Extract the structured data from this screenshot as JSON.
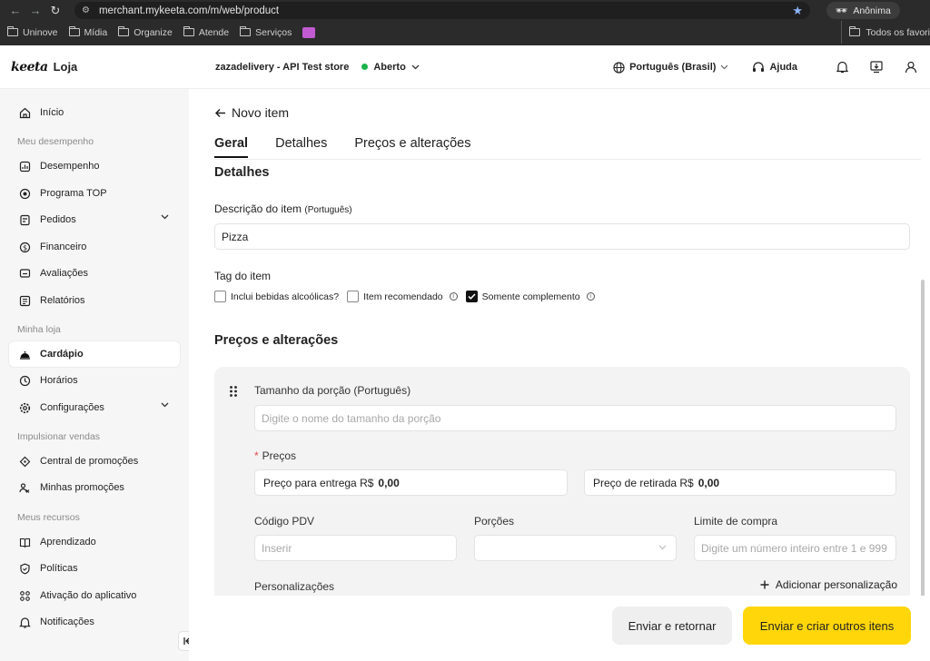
{
  "browser": {
    "url": "merchant.mykeeta.com/m/web/product",
    "profile_label": "Anônima",
    "bookmarks": [
      "Uninove",
      "Mídia",
      "Organize",
      "Atende",
      "Serviços"
    ],
    "bookmarks_all": "Todos os favori"
  },
  "header": {
    "logo_mark": "keeta",
    "logo_text": "Loja",
    "store_name": "zazadelivery - API Test store",
    "status": "Aberto",
    "language": "Português (Brasil)",
    "help": "Ajuda",
    "status_color": "#1bb34a"
  },
  "sidebar": {
    "inicio": "Início",
    "section_desempenho": "Meu desempenho",
    "desempenho": "Desempenho",
    "programa_top": "Programa TOP",
    "pedidos": "Pedidos",
    "financeiro": "Financeiro",
    "avaliacoes": "Avaliações",
    "relatorios": "Relatórios",
    "section_loja": "Minha loja",
    "cardapio": "Cardápio",
    "horarios": "Horários",
    "configuracoes": "Configurações",
    "section_vendas": "Impulsionar vendas",
    "central_promocoes": "Central de promoções",
    "minhas_promocoes": "Minhas promoções",
    "section_recursos": "Meus recursos",
    "aprendizado": "Aprendizado",
    "politicas": "Políticas",
    "ativacao": "Ativação do aplicativo",
    "notificacoes": "Notificações",
    "active_item": "Cardápio"
  },
  "main": {
    "back_label": "Novo item",
    "tabs": [
      "Geral",
      "Detalhes",
      "Preços e alterações"
    ],
    "active_tab": "Geral",
    "detalhes_title": "Detalhes",
    "descricao_label": "Descrição do item",
    "descricao_lang": "(Português)",
    "descricao_value": "Pizza",
    "tag_label": "Tag do item",
    "tags": [
      {
        "label": "Inclui bebidas alcoólicas?",
        "checked": false,
        "info": false
      },
      {
        "label": "Item recomendado",
        "checked": false,
        "info": true
      },
      {
        "label": "Somente complemento",
        "checked": true,
        "info": true
      }
    ],
    "precos_title": "Preços e alterações",
    "porcao_label": "Tamanho da porção (Português)",
    "porcao_placeholder": "Digite o nome do tamanho da porção",
    "precos_label": "Preços",
    "preco_entrega_label": "Preço para entrega R$",
    "preco_entrega_value": "0,00",
    "preco_retirada_label": "Preço de retirada R$",
    "preco_retirada_value": "0,00",
    "codigo_pdv_label": "Código PDV",
    "codigo_pdv_placeholder": "Inserir",
    "porcoes_label": "Porções",
    "limite_label": "Limite de compra",
    "limite_placeholder": "Digite um número inteiro entre 1 e 999",
    "personalizacoes_label": "Personalizações",
    "add_personalizacao": "Adicionar personalização"
  },
  "footer": {
    "secondary_button": "Enviar e retornar",
    "primary_button": "Enviar e criar outros itens",
    "primary_color": "#ffd60a"
  }
}
